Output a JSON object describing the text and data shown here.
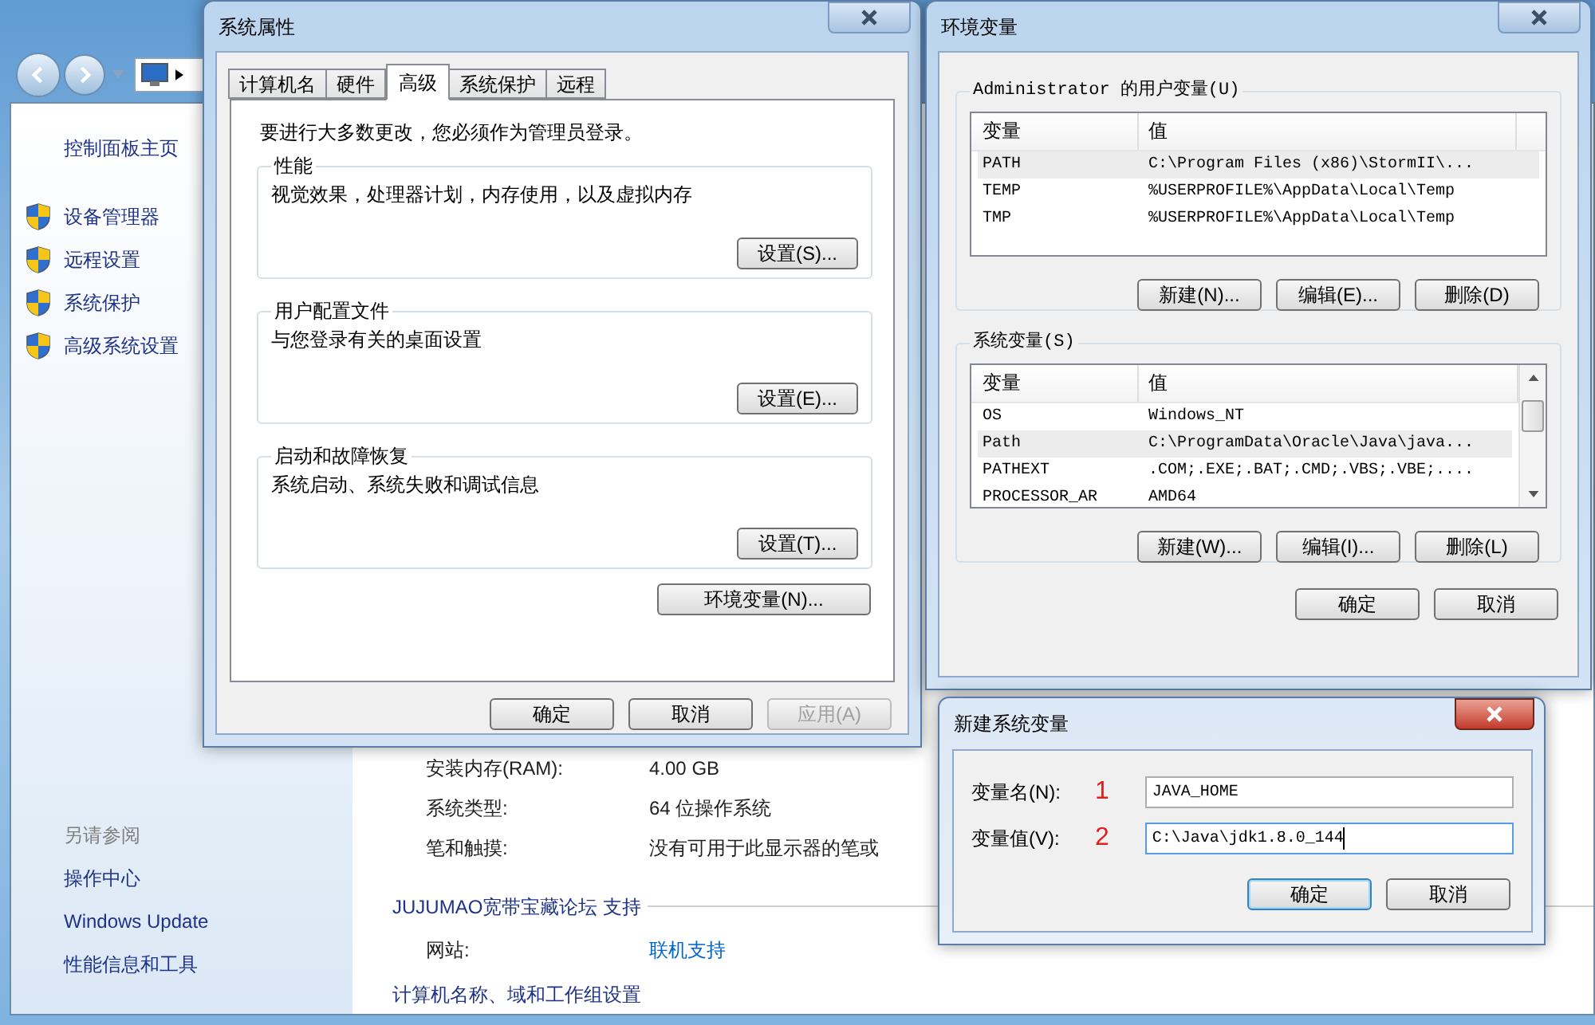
{
  "sidebar": {
    "home_link": "控制面板主页",
    "tasks": [
      "设备管理器",
      "远程设置",
      "系统保护",
      "高级系统设置"
    ],
    "see_also_title": "另请参阅",
    "see_also": [
      "操作中心",
      "Windows Update",
      "性能信息和工具"
    ]
  },
  "main": {
    "rows": [
      {
        "label": "安装内存(RAM):",
        "value": "4.00 GB"
      },
      {
        "label": "系统类型:",
        "value": "64 位操作系统"
      },
      {
        "label": "笔和触摸:",
        "value": "没有可用于此显示器的笔或"
      }
    ],
    "support_heading": "JUJUMAO宽带宝藏论坛 支持",
    "website_label": "网站:",
    "website_link": "联机支持",
    "next_heading": "计算机名称、域和工作组设置"
  },
  "system_properties": {
    "title": "系统属性",
    "tabs": [
      {
        "label": "计算机名",
        "selected": false
      },
      {
        "label": "硬件",
        "selected": false
      },
      {
        "label": "高级",
        "selected": true
      },
      {
        "label": "系统保护",
        "selected": false
      },
      {
        "label": "远程",
        "selected": false
      }
    ],
    "admin_note": "要进行大多数更改，您必须作为管理员登录。",
    "groups": [
      {
        "title": "性能",
        "description": "视觉效果，处理器计划，内存使用，以及虚拟内存",
        "button": "设置(S)..."
      },
      {
        "title": "用户配置文件",
        "description": "与您登录有关的桌面设置",
        "button": "设置(E)..."
      },
      {
        "title": "启动和故障恢复",
        "description": "系统启动、系统失败和调试信息",
        "button": "设置(T)..."
      }
    ],
    "env_button": "环境变量(N)...",
    "buttons": [
      {
        "label": "确定",
        "disabled": false
      },
      {
        "label": "取消",
        "disabled": false
      },
      {
        "label": "应用(A)",
        "disabled": true
      }
    ]
  },
  "environment_variables": {
    "title": "环境变量",
    "user_group": {
      "title": "Administrator 的用户变量(U)",
      "columns": [
        "变量",
        "值"
      ],
      "rows": [
        {
          "name": "PATH",
          "value": "C:\\Program Files (x86)\\StormII\\...",
          "selected": true
        },
        {
          "name": "TEMP",
          "value": "%USERPROFILE%\\AppData\\Local\\Temp",
          "selected": false
        },
        {
          "name": "TMP",
          "value": "%USERPROFILE%\\AppData\\Local\\Temp",
          "selected": false
        }
      ],
      "buttons": [
        "新建(N)...",
        "编辑(E)...",
        "删除(D)"
      ]
    },
    "system_group": {
      "title": "系统变量(S)",
      "columns": [
        "变量",
        "值"
      ],
      "rows": [
        {
          "name": "OS",
          "value": "Windows_NT",
          "selected": false
        },
        {
          "name": "Path",
          "value": "C:\\ProgramData\\Oracle\\Java\\java...",
          "selected": true
        },
        {
          "name": "PATHEXT",
          "value": ".COM;.EXE;.BAT;.CMD;.VBS;.VBE;....",
          "selected": false
        },
        {
          "name": "PROCESSOR_AR",
          "value": "AMD64",
          "selected": false
        }
      ],
      "buttons": [
        "新建(W)...",
        "编辑(I)...",
        "删除(L)"
      ]
    },
    "buttons": [
      "确定",
      "取消"
    ]
  },
  "new_variable": {
    "title": "新建系统变量",
    "fields": [
      {
        "label": "变量名(N):",
        "marker": "1",
        "value": "JAVA_HOME",
        "focused": false
      },
      {
        "label": "变量值(V):",
        "marker": "2",
        "value": "C:\\Java\\jdk1.8.0_144",
        "focused": true
      }
    ],
    "buttons": [
      {
        "label": "确定",
        "default": true
      },
      {
        "label": "取消",
        "default": false
      }
    ]
  }
}
